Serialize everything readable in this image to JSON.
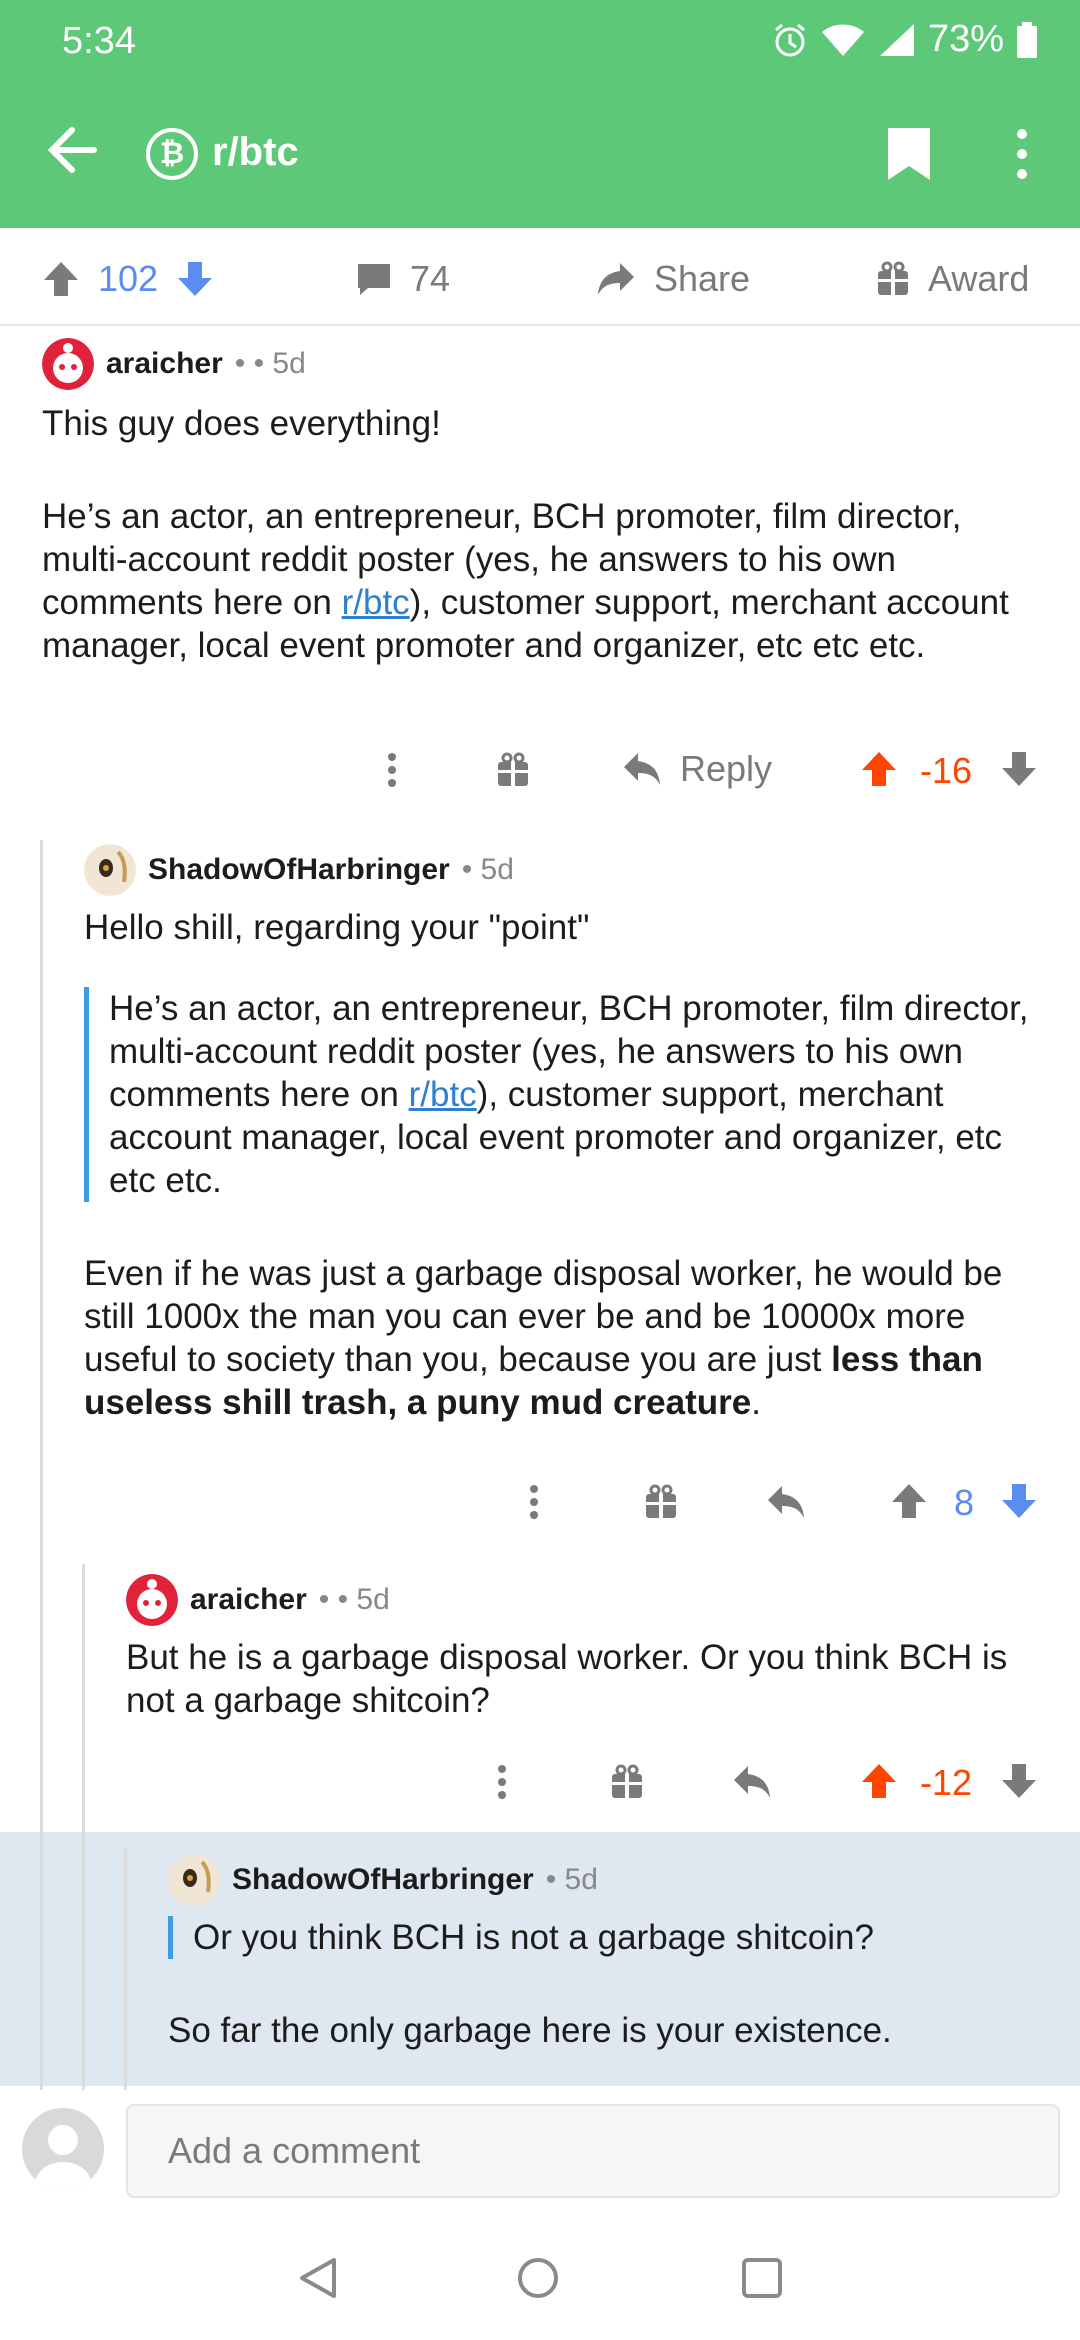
{
  "status": {
    "time": "5:34",
    "battery": "73%"
  },
  "header": {
    "subreddit": "r/btc",
    "sub_icon_glyph": "₿",
    "color": "#5dc878"
  },
  "post_actions": {
    "score": "102",
    "comments": "74",
    "share": "Share",
    "award": "Award"
  },
  "comments": [
    {
      "user": "araicher",
      "meta": "• • 5d",
      "p1": "This guy does everything!",
      "p2_a": "He’s an actor, an entrepreneur, BCH promoter, film director, multi-account reddit poster (yes, he answers to his own comments here on ",
      "p2_link": "r/btc",
      "p2_b": "), customer support, merchant account manager, local event promoter and organizer, etc etc etc.",
      "reply": "Reply",
      "score": "-16"
    },
    {
      "user": "ShadowOfHarbringer",
      "meta": "• 5d",
      "p1": "Hello shill, regarding your \"point\"",
      "quote_a": "He’s an actor, an entrepreneur, BCH promoter, film director, multi-account reddit poster (yes, he answers to his own comments here on ",
      "quote_link": "r/btc",
      "quote_b": "), customer support, merchant account manager, local event promoter and organizer, etc etc etc.",
      "p3_a": "Even if he was just a garbage disposal worker, he would be still 1000x the man you can ever be and be 10000x more useful to society than you, because you are just ",
      "p3_bold": "less than useless shill trash, a puny mud creature",
      "p3_b": ".",
      "score": "8"
    },
    {
      "user": "araicher",
      "meta": "• • 5d",
      "p1": "But he is a garbage disposal worker. Or you think BCH is not a garbage shitcoin?",
      "score": "-12"
    },
    {
      "user": "ShadowOfHarbringer",
      "meta": "• 5d",
      "quote": "Or you think BCH is not a garbage shitcoin?",
      "p1": "So far the only garbage here is your existence."
    }
  ],
  "composer": {
    "placeholder": "Add a comment"
  }
}
